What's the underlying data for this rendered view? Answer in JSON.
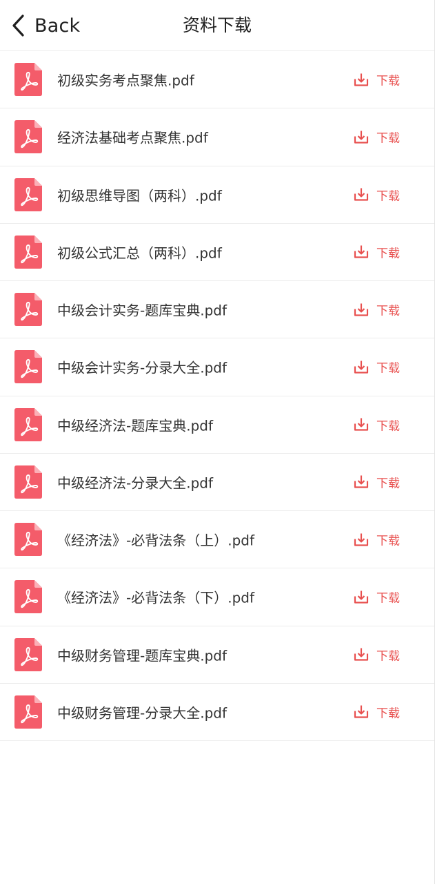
{
  "header": {
    "back_label": "Back",
    "title": "资料下载"
  },
  "colors": {
    "accent": "#e8504f",
    "pdf_icon": "#f45c6a",
    "text": "#333333"
  },
  "files": [
    {
      "name": "初级实务考点聚焦.pdf",
      "action": "下载",
      "icon": "pdf-icon"
    },
    {
      "name": "经济法基础考点聚焦.pdf",
      "action": "下载",
      "icon": "pdf-icon"
    },
    {
      "name": "初级思维导图（两科）.pdf",
      "action": "下载",
      "icon": "pdf-icon"
    },
    {
      "name": "初级公式汇总（两科）.pdf",
      "action": "下载",
      "icon": "pdf-icon"
    },
    {
      "name": "中级会计实务-题库宝典.pdf",
      "action": "下载",
      "icon": "pdf-icon"
    },
    {
      "name": "中级会计实务-分录大全.pdf",
      "action": "下载",
      "icon": "pdf-icon"
    },
    {
      "name": "中级经济法-题库宝典.pdf",
      "action": "下载",
      "icon": "pdf-icon"
    },
    {
      "name": "中级经济法-分录大全.pdf",
      "action": "下载",
      "icon": "pdf-icon"
    },
    {
      "name": "《经济法》-必背法条（上）.pdf",
      "action": "下载",
      "icon": "pdf-icon"
    },
    {
      "name": "《经济法》-必背法条（下）.pdf",
      "action": "下载",
      "icon": "pdf-icon"
    },
    {
      "name": "中级财务管理-题库宝典.pdf",
      "action": "下载",
      "icon": "pdf-icon"
    },
    {
      "name": "中级财务管理-分录大全.pdf",
      "action": "下载",
      "icon": "pdf-icon"
    }
  ]
}
